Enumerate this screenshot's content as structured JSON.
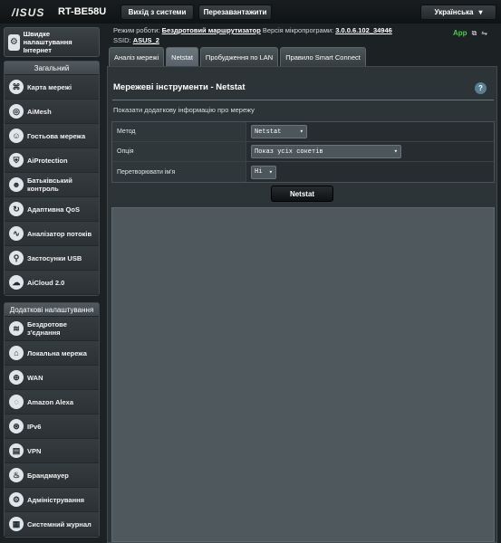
{
  "header": {
    "logo": "/ISUS",
    "model": "RT-BE58U",
    "logout_label": "Вихід з системи",
    "reboot_label": "Перезавантажити",
    "language": "Українська"
  },
  "status": {
    "mode_label": "Режим роботи:",
    "mode_value": "Бездротовий маршрутизатор",
    "firmware_label": "Версія мікропрограми:",
    "firmware_value": "3.0.0.6.102_34946",
    "ssid_label": "SSID:",
    "ssid_value": "ASUS_2",
    "app_label": "App"
  },
  "sidebar": {
    "quick_setup": "Швидке налаштування Інтернет",
    "general_title": "Загальний",
    "general_items": [
      {
        "label": "Карта мережі",
        "icon": "network-map-icon",
        "glyph": "⌘"
      },
      {
        "label": "AiMesh",
        "icon": "aimesh-icon",
        "glyph": "◎"
      },
      {
        "label": "Гостьова мережа",
        "icon": "guest-network-icon",
        "glyph": "☺"
      },
      {
        "label": "AiProtection",
        "icon": "shield-icon",
        "glyph": "⛨"
      },
      {
        "label": "Батьківський контроль",
        "icon": "parental-control-icon",
        "glyph": "☻"
      },
      {
        "label": "Адаптивна QoS",
        "icon": "qos-icon",
        "glyph": "↻"
      },
      {
        "label": "Аналізатор потоків",
        "icon": "traffic-analyzer-icon",
        "glyph": "∿"
      },
      {
        "label": "Застосунки USB",
        "icon": "usb-icon",
        "glyph": "⚲"
      },
      {
        "label": "AiCloud 2.0",
        "icon": "cloud-icon",
        "glyph": "☁"
      }
    ],
    "advanced_title": "Додаткові налаштування",
    "advanced_items": [
      {
        "label": "Бездротове з'єднання",
        "icon": "wireless-icon",
        "glyph": "≋"
      },
      {
        "label": "Локальна мережа",
        "icon": "lan-icon",
        "glyph": "⌂"
      },
      {
        "label": "WAN",
        "icon": "wan-icon",
        "glyph": "⊕"
      },
      {
        "label": "Amazon Alexa",
        "icon": "alexa-icon",
        "glyph": "◌"
      },
      {
        "label": "IPv6",
        "icon": "ipv6-icon",
        "glyph": "⊛"
      },
      {
        "label": "VPN",
        "icon": "vpn-icon",
        "glyph": "▤"
      },
      {
        "label": "Брандмауер",
        "icon": "firewall-icon",
        "glyph": "♨"
      },
      {
        "label": "Адміністрування",
        "icon": "administration-icon",
        "glyph": "⚙"
      },
      {
        "label": "Системний журнал",
        "icon": "system-log-icon",
        "glyph": "▦"
      }
    ]
  },
  "tabs": [
    {
      "label": "Аналіз мережі",
      "active": false
    },
    {
      "label": "Netstat",
      "active": true
    },
    {
      "label": "Пробудження по LAN",
      "active": false
    },
    {
      "label": "Правило Smart Connect",
      "active": false
    }
  ],
  "main": {
    "title": "Мережеві інструменти - Netstat",
    "subtitle": "Показати додаткову інформацію про мережу",
    "fields": [
      {
        "label": "Метод",
        "value": "Netstat"
      },
      {
        "label": "Опція",
        "value": "Показ усіх сокетів"
      },
      {
        "label": "Перетворювати ім'я",
        "value": "Ні"
      }
    ],
    "run_button": "Netstat"
  }
}
